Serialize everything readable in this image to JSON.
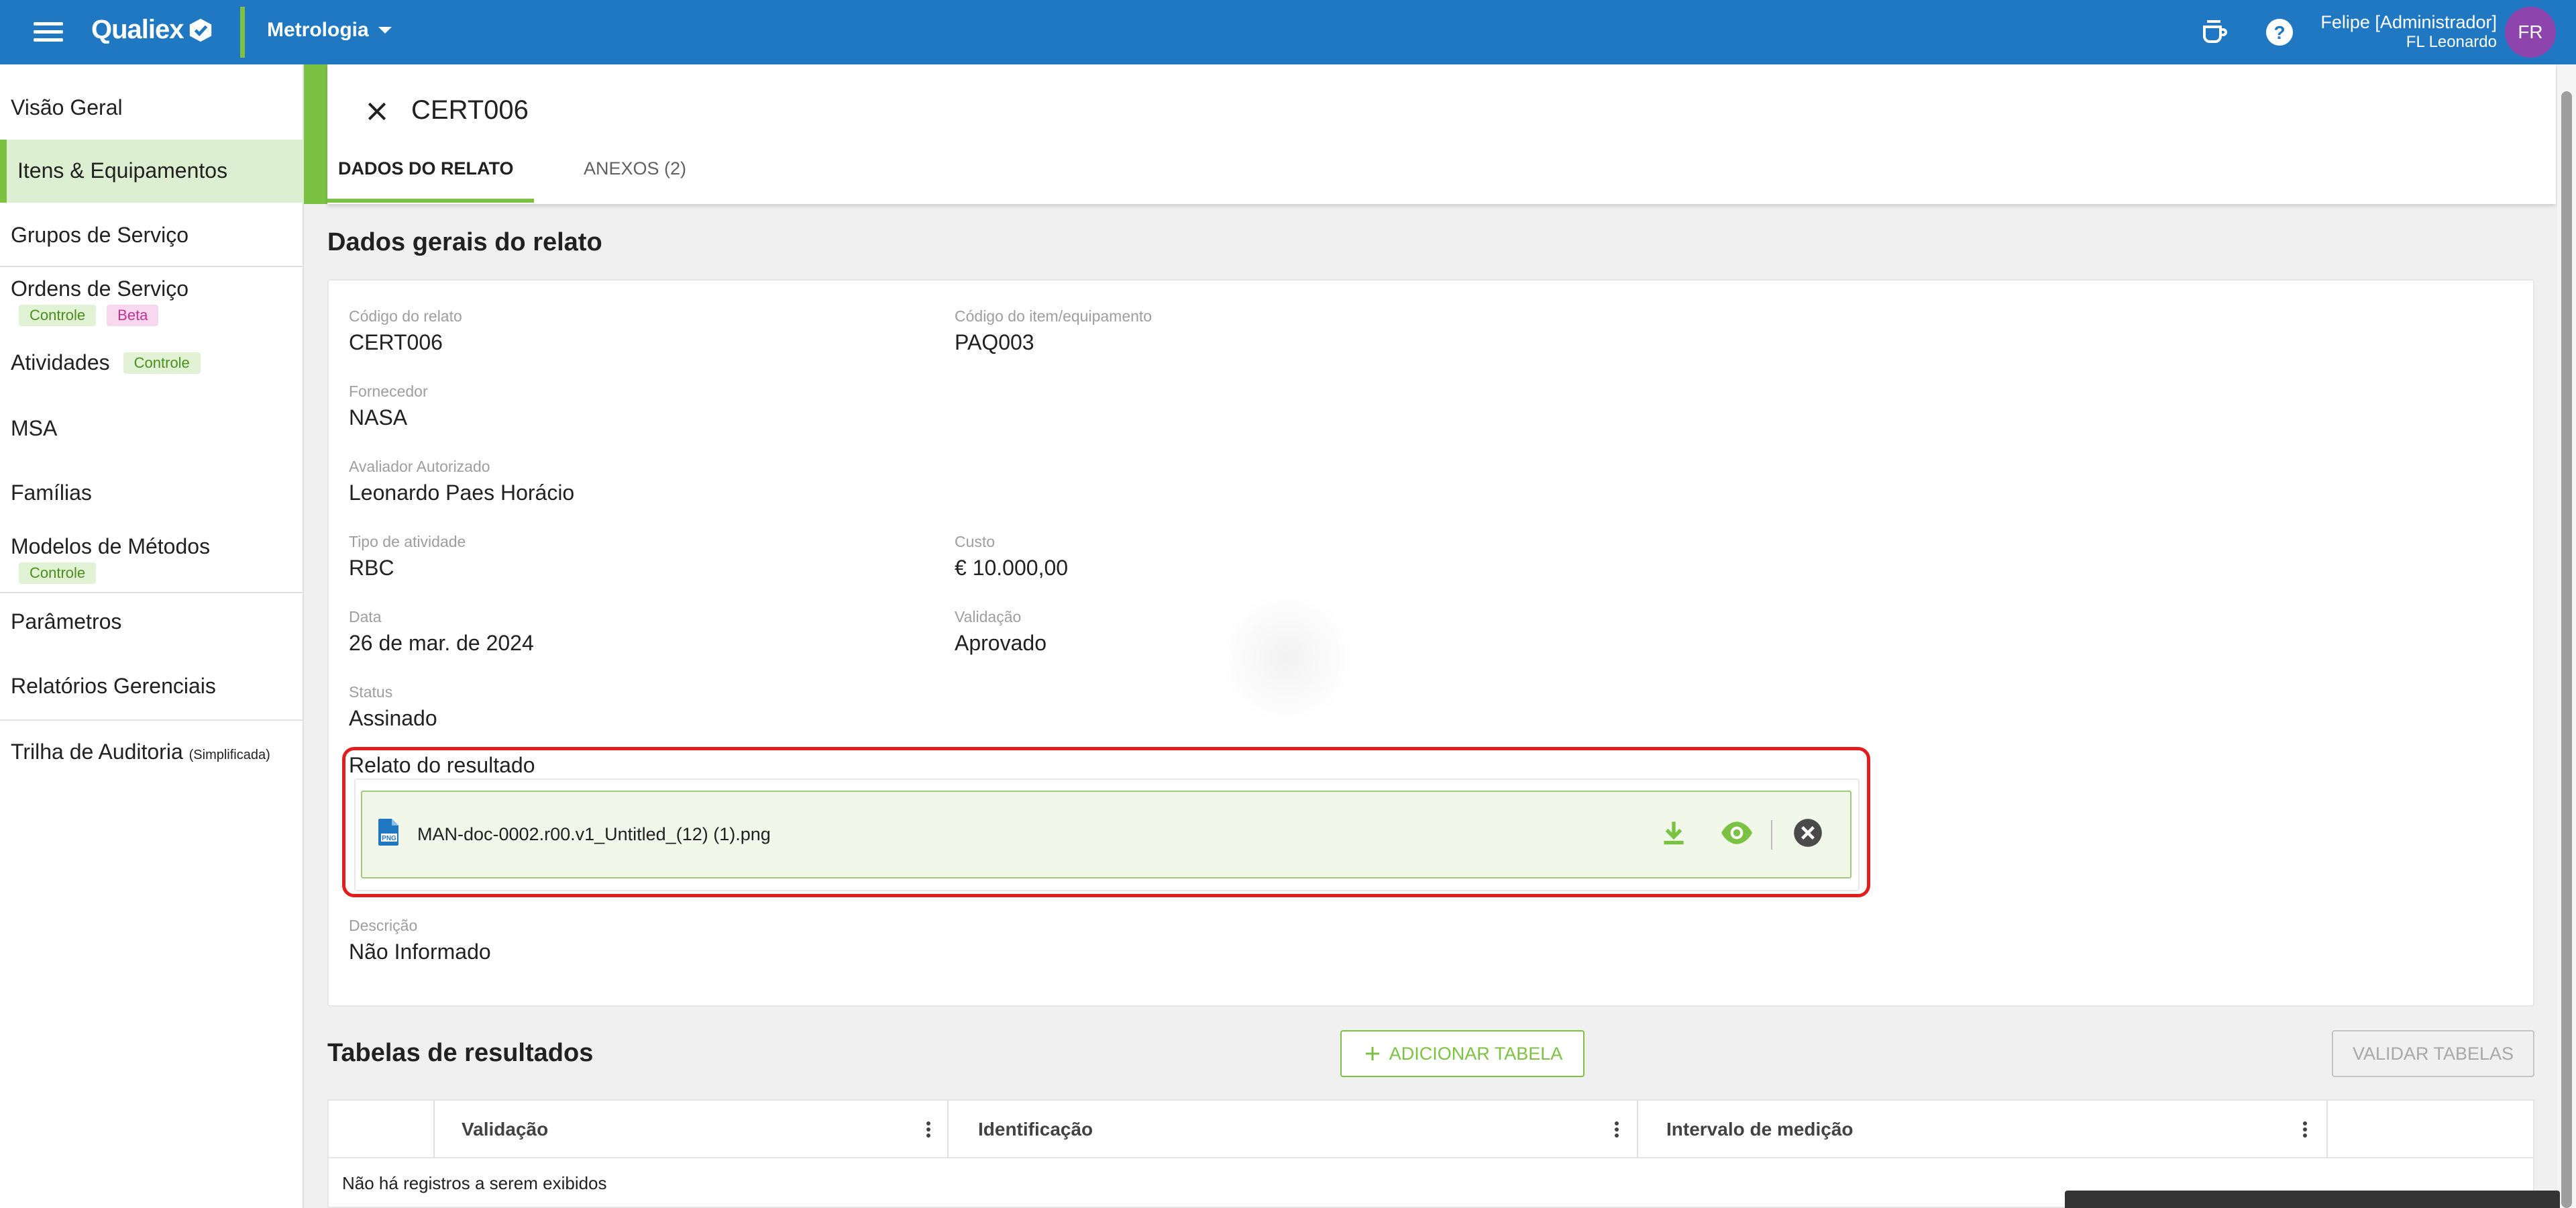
{
  "app": {
    "brand": "Qualiex",
    "module": "Metrologia"
  },
  "user": {
    "name": "Felipe [Administrador]",
    "org": "FL Leonardo",
    "initials": "FR"
  },
  "sidebar": {
    "items": [
      {
        "label": "Visão Geral"
      },
      {
        "label": "Itens & Equipamentos",
        "active": true
      },
      {
        "label": "Grupos de Serviço"
      },
      {
        "label": "Ordens de Serviço",
        "tags": [
          "Controle",
          "Beta"
        ]
      },
      {
        "label": "Atividades",
        "tags": [
          "Controle"
        ]
      },
      {
        "label": "MSA"
      },
      {
        "label": "Famílias"
      },
      {
        "label": "Modelos de Métodos",
        "tags": [
          "Controle"
        ]
      },
      {
        "label": "Parâmetros"
      },
      {
        "label": "Relatórios Gerenciais"
      },
      {
        "label": "Trilha de Auditoria",
        "suffix": "(Simplificada)"
      }
    ]
  },
  "panel": {
    "title": "CERT006",
    "tabs": [
      {
        "label": "DADOS DO RELATO",
        "active": true
      },
      {
        "label": "ANEXOS (2)"
      }
    ]
  },
  "general": {
    "section_title": "Dados gerais do relato",
    "fields": {
      "codigo_relato": {
        "label": "Código do relato",
        "value": "CERT006"
      },
      "codigo_item": {
        "label": "Código do item/equipamento",
        "value": "PAQ003"
      },
      "fornecedor": {
        "label": "Fornecedor",
        "value": "NASA"
      },
      "avaliador": {
        "label": "Avaliador Autorizado",
        "value": "Leonardo Paes Horácio"
      },
      "tipo": {
        "label": "Tipo de atividade",
        "value": "RBC"
      },
      "custo": {
        "label": "Custo",
        "value": "€ 10.000,00"
      },
      "data": {
        "label": "Data",
        "value": "26 de mar. de 2024"
      },
      "validacao": {
        "label": "Validação",
        "value": "Aprovado"
      },
      "status": {
        "label": "Status",
        "value": "Assinado"
      },
      "descricao": {
        "label": "Descrição",
        "value": "Não Informado"
      }
    },
    "result_report": {
      "label": "Relato do resultado",
      "file_name": "MAN-doc-0002.r00.v1_Untitled_(12) (1).png"
    }
  },
  "results": {
    "section_title": "Tabelas de resultados",
    "add_button": "ADICIONAR TABELA",
    "validate_button": "VALIDAR TABELAS",
    "columns": [
      "Validação",
      "Identificação",
      "Intervalo de medição"
    ],
    "empty_text": "Não há registros a serem exibidos"
  },
  "colors": {
    "topbar": "#1f78c1",
    "accent": "#7cc242",
    "highlight": "#e21d1d",
    "avatar": "#8e44ad"
  },
  "icons": [
    "menu-icon",
    "qualiex-logo-icon",
    "coffee-cup-icon",
    "help-icon",
    "close-icon",
    "png-file-icon",
    "download-icon",
    "eye-icon",
    "remove-circle-icon",
    "plus-icon",
    "more-vert-icon"
  ]
}
